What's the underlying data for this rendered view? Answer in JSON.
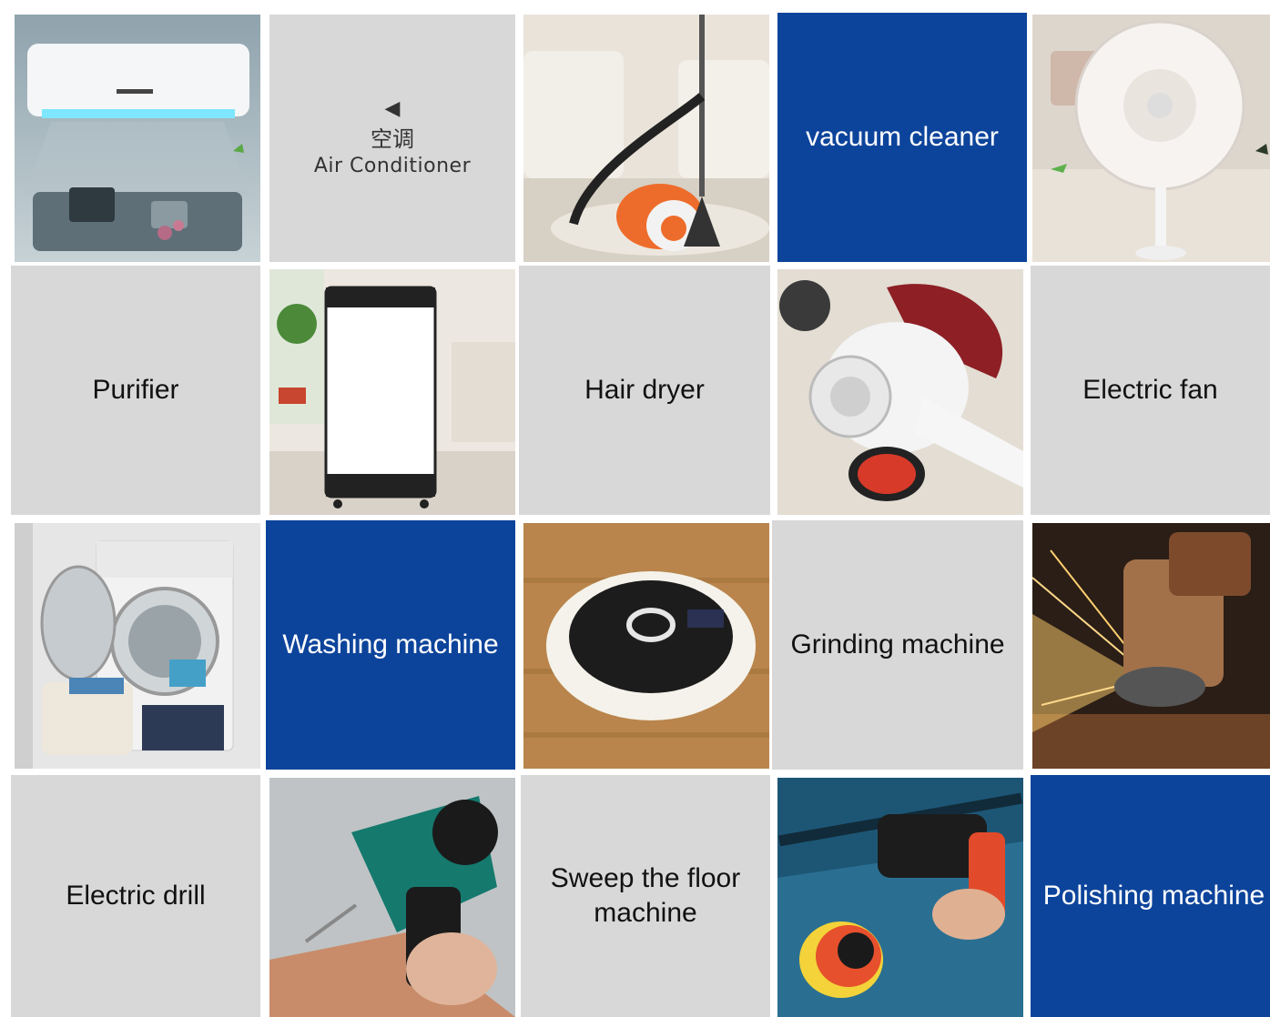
{
  "nav_tile": {
    "arrow_icon": "◀",
    "label_cn": "空调",
    "label_en": "Air Conditioner"
  },
  "labels": {
    "vacuum": "vacuum cleaner",
    "purifier": "Purifier",
    "hair_dryer": "Hair dryer",
    "electric_fan": "Electric fan",
    "washing": "Washing machine",
    "grinding": "Grinding machine",
    "drill": "Electric drill",
    "sweep": "Sweep the floor machine",
    "polishing": "Polishing machine"
  },
  "colors": {
    "accent_blue": "#0d449b",
    "tile_gray": "#d8d8d8"
  }
}
